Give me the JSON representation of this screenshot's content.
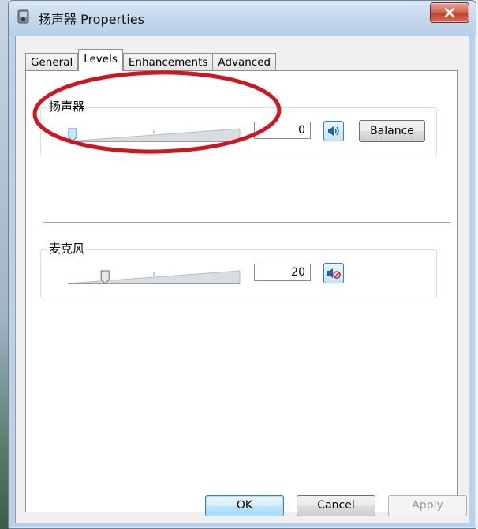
{
  "window": {
    "title": "扬声器 Properties"
  },
  "tabs": [
    {
      "label": "General",
      "active": false
    },
    {
      "label": "Levels",
      "active": true
    },
    {
      "label": "Enhancements",
      "active": false
    },
    {
      "label": "Advanced",
      "active": false
    }
  ],
  "speaker_group": {
    "label": "扬声器",
    "level_value": "0",
    "level_fraction": 0.0,
    "mute_icon": "speaker-on-icon",
    "balance_label": "Balance"
  },
  "mic_group": {
    "label": "麦克风",
    "level_value": "20",
    "level_fraction": 0.2,
    "mute_icon": "speaker-muted-icon"
  },
  "buttons": {
    "ok": "OK",
    "cancel": "Cancel",
    "apply": "Apply"
  },
  "colors": {
    "annotation": "#d2141e",
    "accent": "#3c7fb1"
  }
}
